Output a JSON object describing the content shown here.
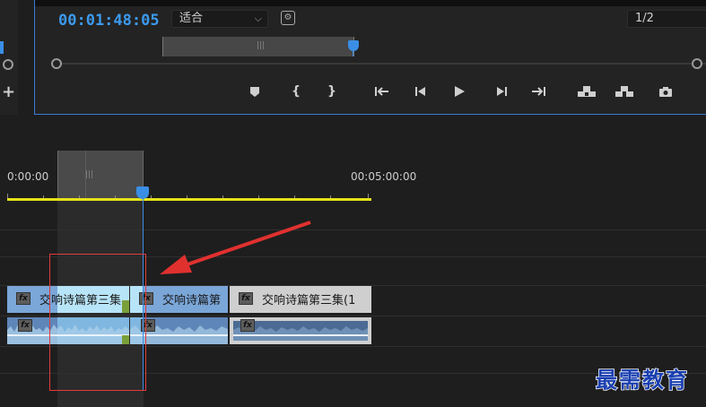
{
  "monitor": {
    "timecode": "00:01:48:05",
    "fit_select": "适合",
    "resolution_select": "1/2",
    "transport": [
      {
        "name": "add-marker-button",
        "glyph": "⬟"
      },
      {
        "name": "mark-in-button",
        "glyph": "{"
      },
      {
        "name": "mark-out-button",
        "glyph": "}"
      },
      {
        "name": "go-to-in-button",
        "glyph": "{←"
      },
      {
        "name": "step-back-button",
        "glyph": "◀|"
      },
      {
        "name": "play-button",
        "glyph": "▶"
      },
      {
        "name": "step-forward-button",
        "glyph": "|▶"
      },
      {
        "name": "go-to-out-button",
        "glyph": "→}"
      },
      {
        "name": "lift-button",
        "glyph": "⏏"
      },
      {
        "name": "extract-button",
        "glyph": "⏏"
      },
      {
        "name": "export-frame-button",
        "glyph": "📷"
      }
    ]
  },
  "timeline": {
    "ruler_start": "0:00:00",
    "ruler_mark": "00:05:00:00",
    "clips_video": [
      {
        "label": "交响诗篇第三集",
        "color": "#7aa6d8"
      },
      {
        "label": "交响诗篇第",
        "color": "#7aa6d8"
      },
      {
        "label": "交响诗篇第三集(1",
        "color": "#cfcfcf"
      }
    ],
    "fx_label": "fx"
  },
  "watermark": "最需教育"
}
